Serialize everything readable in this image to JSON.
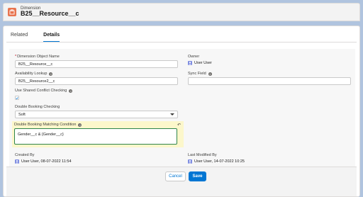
{
  "header": {
    "object_type": "Dimension",
    "record_name": "B25__Resource__c"
  },
  "tabs": [
    {
      "label": "Related",
      "active": false
    },
    {
      "label": "Details",
      "active": true
    }
  ],
  "fields": {
    "dimension_object_name": {
      "label": "Dimension Object Name",
      "required": true,
      "value": "B25__Resource__c"
    },
    "owner": {
      "label": "Owner",
      "value": "User User"
    },
    "availability_lookup": {
      "label": "Availability Lookup",
      "value": "B25__Resource2__c"
    },
    "sync_field": {
      "label": "Sync Field",
      "value": ""
    },
    "use_shared_conflict_checking": {
      "label": "Use Shared Conflict Checking",
      "checked": true
    },
    "double_booking_checking": {
      "label": "Double Booking Checking",
      "value": "Soft"
    },
    "double_booking_matching_condition": {
      "label": "Double Booking Matching Condition",
      "value": "Gender__c & {Gender__c}"
    },
    "created_by": {
      "label": "Created By",
      "value": "User User, 08-07-2022 11:54"
    },
    "last_modified_by": {
      "label": "Last Modified By",
      "value": "User User, 14-07-2022 10:25"
    }
  },
  "footer": {
    "cancel_label": "Cancel",
    "save_label": "Save"
  },
  "colors": {
    "brand": "#0176d3",
    "object_icon": "#e8744f",
    "edited_highlight": "#fcf7cb",
    "required": "#ba0517"
  },
  "icons": {
    "object": "dimension-object-icon",
    "info": "info-icon",
    "user": "user-avatar-icon",
    "undo": "undo-icon",
    "dropdown": "chevron-down-icon"
  }
}
